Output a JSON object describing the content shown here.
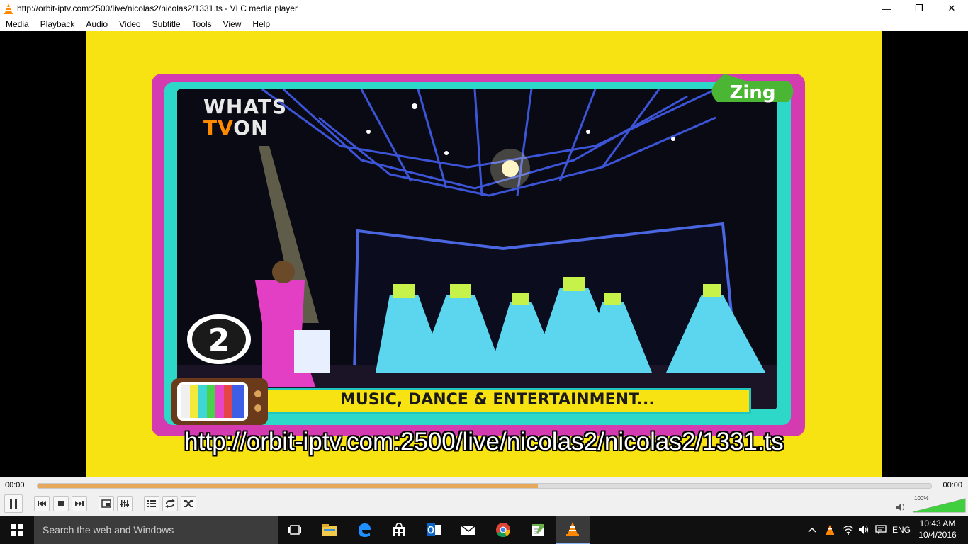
{
  "window": {
    "title": "http://orbit-iptv.com:2500/live/nicolas2/nicolas2/1331.ts - VLC media player",
    "controls": {
      "minimize": "—",
      "maximize": "❐",
      "close": "✕"
    }
  },
  "menu": [
    "Media",
    "Playback",
    "Audio",
    "Video",
    "Subtitle",
    "Tools",
    "View",
    "Help"
  ],
  "video": {
    "channel_logo_line1": "WHATS",
    "channel_logo_tv": "TV",
    "channel_logo_line2": "ON",
    "brand": "Zing",
    "episode_number": "2",
    "caption": "MUSIC, DANCE & ENTERTAINMENT...",
    "osd_url": "http://orbit-iptv.com:2500/live/nicolas2/nicolas2/1331.ts"
  },
  "playback": {
    "elapsed": "00:00",
    "remaining": "00:00",
    "buffer_fraction": 0.56,
    "volume_percent_label": "100%",
    "volume_fraction": 1.0
  },
  "taskbar": {
    "search_placeholder": "Search the web and Windows",
    "language": "ENG",
    "time": "10:43 AM",
    "date": "10/4/2016"
  },
  "colors": {
    "frame_yellow": "#f7e311",
    "tv_magenta": "#d43bb1",
    "tv_cyan": "#2ed8c8",
    "seek_fill": "#e6a85a",
    "vlc_orange": "#ff8800"
  }
}
